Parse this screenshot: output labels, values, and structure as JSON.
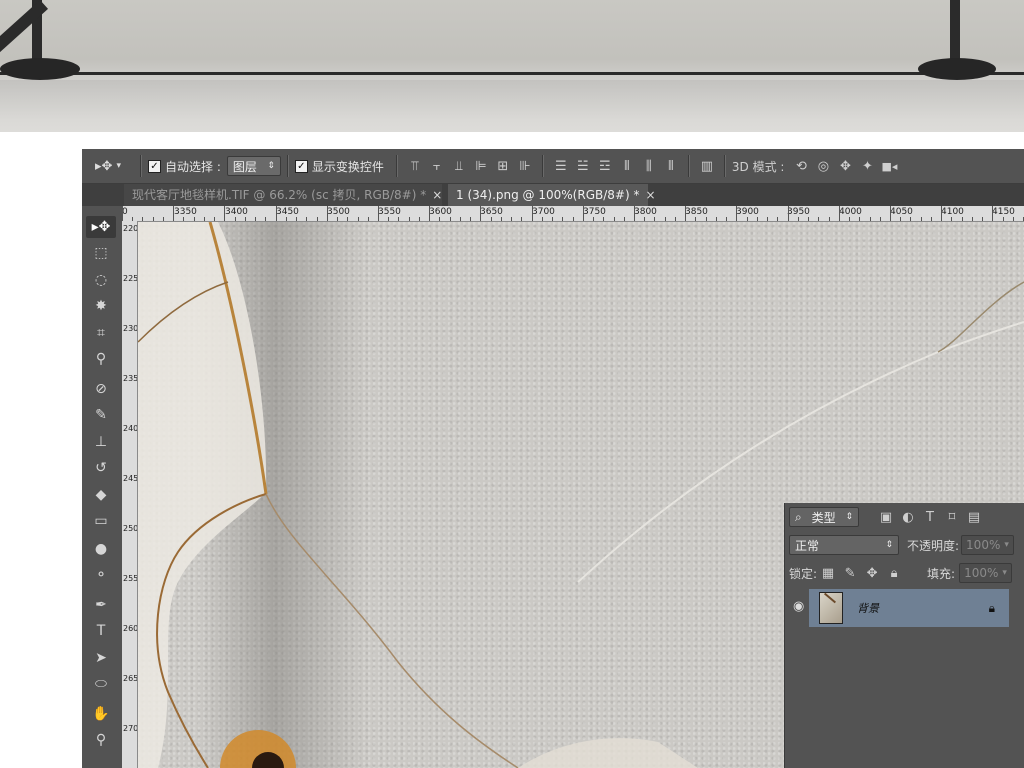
{
  "options_bar": {
    "auto_select_label": "自动选择 :",
    "auto_select_value": "图层",
    "show_transform_label": "显示变换控件",
    "mode_3d_label": "3D 模式 :"
  },
  "tabs": [
    {
      "label": "现代客厅地毯样机.TIF @ 66.2% (sc 拷贝, RGB/8#) *",
      "close": "×"
    },
    {
      "label": "1 (34).png @ 100%(RGB/8#) *",
      "close": "×"
    }
  ],
  "ruler_top": [
    "0",
    "3350",
    "3400",
    "3450",
    "3500",
    "3550",
    "3600",
    "3650",
    "3700",
    "3750",
    "3800",
    "3850",
    "3900",
    "3950",
    "4000",
    "4050",
    "4100",
    "4150"
  ],
  "ruler_left": [
    "2200",
    "2250",
    "2300",
    "2350",
    "2400",
    "2450",
    "2500",
    "2550",
    "2600",
    "2650",
    "2700"
  ],
  "layers_panel": {
    "filter_label": "类型",
    "blend_mode": "正常",
    "opacity_label": "不透明度:",
    "opacity_value": "100%",
    "lock_label": "锁定:",
    "fill_label": "填充:",
    "fill_value": "100%",
    "layer_name": "背景"
  },
  "colors": {
    "ui_bg": "#535353",
    "tab_active": "#595959",
    "selected_layer": "#6f8094"
  }
}
